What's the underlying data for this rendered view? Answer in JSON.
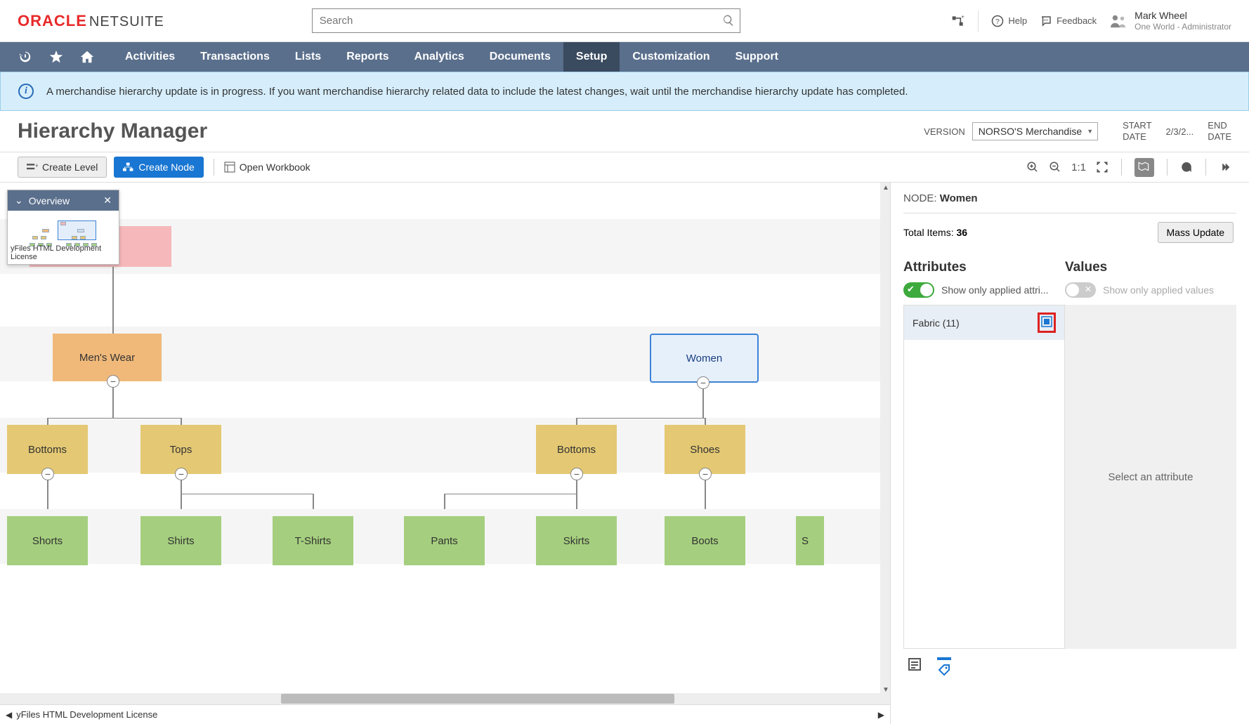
{
  "header": {
    "logo_oracle": "ORACLE",
    "logo_netsuite": "NETSUITE",
    "search_placeholder": "Search",
    "help": "Help",
    "feedback": "Feedback",
    "user_name": "Mark Wheel",
    "user_role": "One World - Administrator"
  },
  "nav": {
    "items": [
      "Activities",
      "Transactions",
      "Lists",
      "Reports",
      "Analytics",
      "Documents",
      "Setup",
      "Customization",
      "Support"
    ],
    "active_index": 6
  },
  "banner": {
    "message": "A merchandise hierarchy update is in progress. If you want merchandise hierarchy related data to include the latest changes, wait until the merchandise hierarchy update has completed."
  },
  "page": {
    "title": "Hierarchy Manager",
    "version_label": "VERSION",
    "version_value": "NORSO'S Merchandise",
    "start_date_label1": "START",
    "start_date_label2": "DATE",
    "date_value": "2/3/2...",
    "end_date_label1": "END",
    "end_date_label2": "DATE"
  },
  "toolbar": {
    "create_level": "Create Level",
    "create_node": "Create Node",
    "open_workbook": "Open Workbook",
    "ratio": "1:1"
  },
  "overview": {
    "title": "Overview",
    "license": "yFiles HTML Development License"
  },
  "nodes": {
    "mens_wear": "Men's Wear",
    "women": "Women",
    "bottoms1": "Bottoms",
    "tops": "Tops",
    "bottoms2": "Bottoms",
    "shoes": "Shoes",
    "shorts": "Shorts",
    "shirts": "Shirts",
    "tshirts": "T-Shirts",
    "pants": "Pants",
    "skirts": "Skirts",
    "boots": "Boots",
    "partial": "S"
  },
  "canvas_footer": "yFiles HTML Development License",
  "side": {
    "node_label": "NODE:",
    "node_value": "Women",
    "total_items_label": "Total Items:",
    "total_items_value": "36",
    "mass_update": "Mass Update",
    "attributes_title": "Attributes",
    "values_title": "Values",
    "show_applied_attr": "Show only applied attri...",
    "show_applied_val": "Show only applied values",
    "fabric_label": "Fabric (11)",
    "select_attr": "Select an attribute"
  }
}
